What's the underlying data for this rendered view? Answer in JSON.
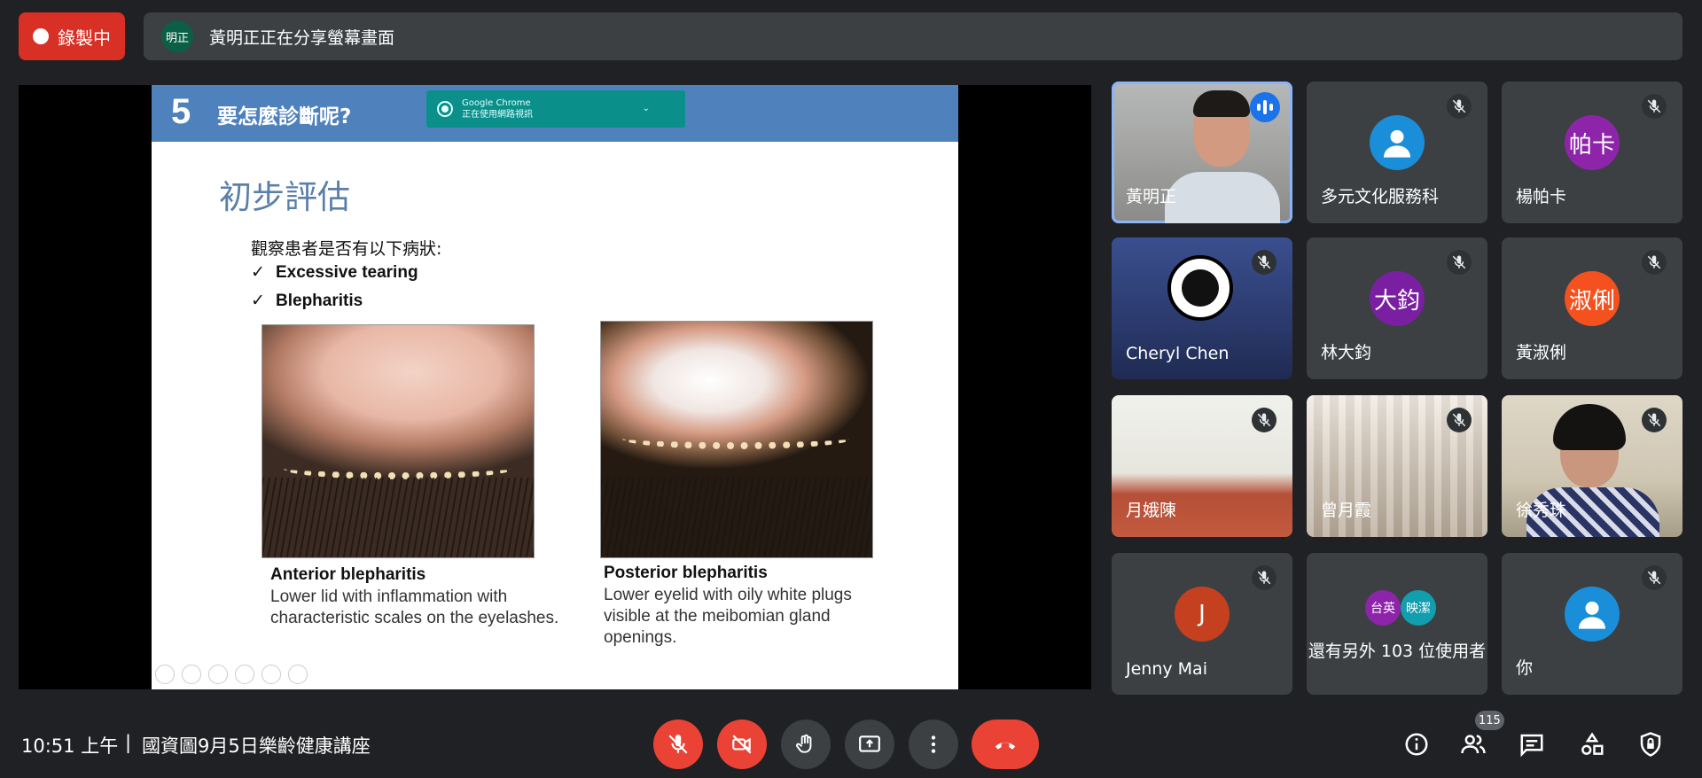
{
  "recording": {
    "label": "錄製中"
  },
  "share_bar": {
    "avatar": "明正",
    "text": "黃明正正在分享螢幕畫面"
  },
  "slide": {
    "number": "5",
    "heading": "要怎麼診斷呢?",
    "chrome_notice": {
      "app": "Google Chrome",
      "text": "正在使用網路視訊"
    },
    "subtitle": "初步評估",
    "lead": "觀察患者是否有以下病狀:",
    "bullets": [
      "Excessive tearing",
      "Blepharitis"
    ],
    "tick": "✓",
    "left_caption": {
      "title": "Anterior blepharitis",
      "text": "Lower lid with inflammation with characteristic scales on the eyelashes."
    },
    "right_caption": {
      "title": "Posterior blepharitis",
      "text": "Lower eyelid with oily white plugs visible at the meibomian gland openings."
    }
  },
  "participants": [
    {
      "name": "黃明正",
      "speaking": true
    },
    {
      "name": "多元文化服務科",
      "muted": true
    },
    {
      "name": "楊帕卡",
      "avatar": "帕卡",
      "avatar_color": "#8e24aa",
      "muted": true
    },
    {
      "name": "Cheryl Chen",
      "muted": true
    },
    {
      "name": "林大鈞",
      "avatar": "大鈞",
      "avatar_color": "#7b1fa2",
      "muted": true
    },
    {
      "name": "黃淑俐",
      "avatar": "淑俐",
      "avatar_color": "#f4511e",
      "muted": true
    },
    {
      "name": "月娥陳",
      "muted": true
    },
    {
      "name": "曾月霞",
      "muted": true
    },
    {
      "name": "徐秀珠",
      "muted": true
    },
    {
      "name": "Jenny Mai",
      "avatar": "J",
      "avatar_color": "#c5401f",
      "muted": true
    },
    {
      "name": "還有另外 103 位使用者",
      "avatars": [
        "台英",
        "映潔"
      ],
      "avatar_colors": [
        "#8e24aa",
        "#129eaf"
      ]
    },
    {
      "name": "你",
      "muted": true
    }
  ],
  "bottom": {
    "time": "10:51 上午",
    "separator": "|",
    "meeting": "國資圖9月5日樂齡健康講座",
    "participant_count": "115"
  },
  "colors": {
    "accent": "#8ab4f8",
    "danger": "#ea4335",
    "surface": "#3c4043",
    "background": "#202124"
  }
}
